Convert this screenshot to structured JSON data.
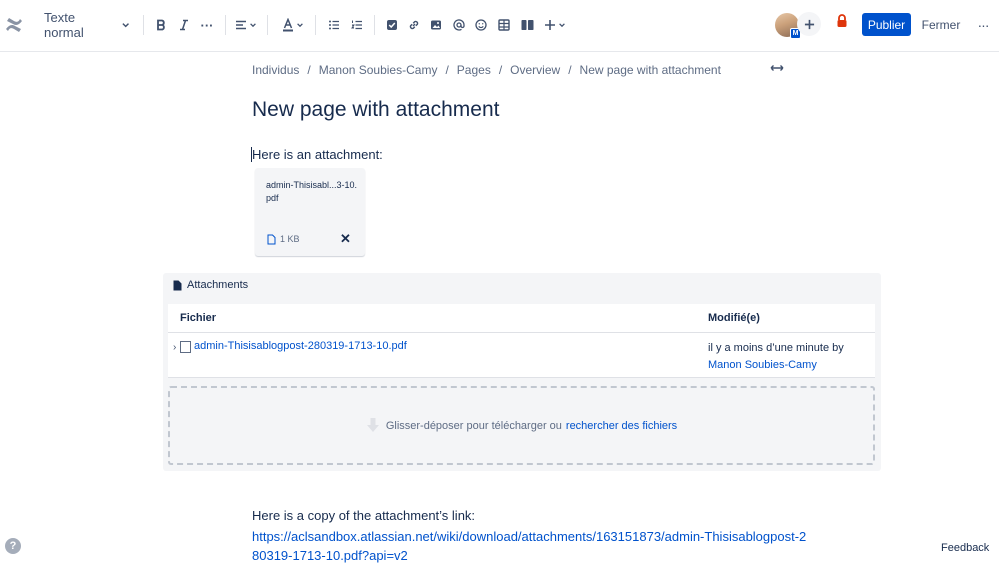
{
  "toolbar": {
    "text_style": "Texte normal",
    "more_formatting": "···",
    "publish_label": "Publier",
    "close_label": "Fermer",
    "more_label": "···",
    "avatar_badge": "M",
    "icons": [
      "confluence-logo",
      "bold",
      "italic",
      "more-formatting",
      "alignment",
      "text-color",
      "bullet-list",
      "numbered-list",
      "action-item",
      "link",
      "image",
      "mention",
      "emoji",
      "table",
      "layouts",
      "insert-more",
      "invite",
      "restrictions-lock",
      "more-actions"
    ],
    "accent_color": "#0052cc",
    "lock_color": "#de350b"
  },
  "breadcrumb": [
    "Individus",
    "Manon Soubies-Camy",
    "Pages",
    "Overview",
    "New page with attachment"
  ],
  "page": {
    "title": "New page with attachment",
    "intro": "Here is an attachment:",
    "link_intro": "Here is a copy of the attachment’s link:",
    "link_url": "https://aclsandbox.atlassian.net/wiki/download/attachments/163151873/admin-Thisisablogpost-280319-1713-10.pdf?api=v2"
  },
  "file_card": {
    "name": "admin-Thisisabl...3-10.pdf",
    "size": "1 KB",
    "remove": "✕"
  },
  "attachments": {
    "heading": "Attachments",
    "columns": [
      "Fichier",
      "Modifié(e)"
    ],
    "rows": [
      {
        "file": "admin-Thisisablogpost-280319-1713-10.pdf",
        "modified": "il y a moins d’une minute by",
        "author": "Manon Soubies-Camy"
      }
    ],
    "drop_text": "Glisser-déposer pour télécharger ou",
    "search_link": "rechercher des fichiers"
  },
  "footer": {
    "help": "?",
    "feedback": "Feedback"
  }
}
